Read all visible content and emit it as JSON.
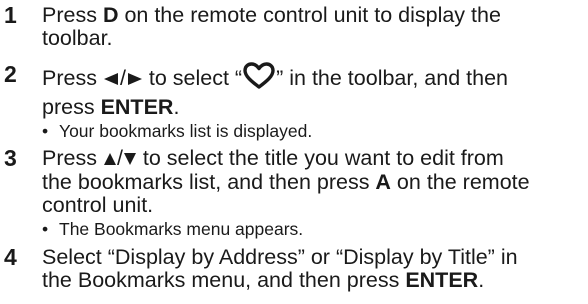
{
  "steps": [
    {
      "number": "1",
      "pre": "Press ",
      "key": "D",
      "post_line1": " on the remote control unit to display the",
      "line2": "toolbar."
    },
    {
      "number": "2",
      "pre": "Press ",
      "arrow_icons": "left-arrow/right-arrow",
      "mid": " to select “",
      "heart_icon": "heart-icon",
      "mid2": "” in the toolbar, and then",
      "line2_pre": "press ",
      "key": "ENTER",
      "line2_post": ".",
      "bullet": "Your bookmarks list is displayed."
    },
    {
      "number": "3",
      "pre": "Press ",
      "arrow_icons": "up-arrow/down-arrow",
      "mid": " to select the title you want to edit from",
      "line2_pre": "the bookmarks list, and then press ",
      "key": "A",
      "line2_post": " on the remote",
      "line3": "control unit.",
      "bullet": "The Bookmarks menu appears."
    },
    {
      "number": "4",
      "line1": "Select “Display by Address” or “Display by Title” in",
      "line2_pre": "the Bookmarks menu, and then press ",
      "key": "ENTER",
      "line2_post": "."
    }
  ],
  "colors": {
    "text": "#1a1a1a"
  }
}
